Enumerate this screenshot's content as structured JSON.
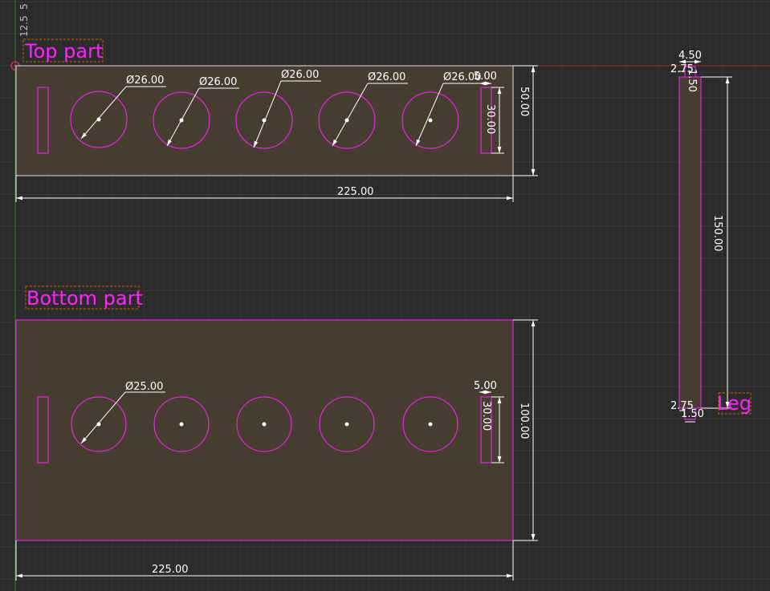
{
  "colors": {
    "background": "#2b2b2b",
    "grid_minor": "#383838",
    "grid_major": "#484848",
    "part_fill": "#4b4031",
    "part_outline_selected": "#ff22ff",
    "part_outline_default": "#e0e0e0",
    "dimension": "#ffffff",
    "axis_x": "#b03030",
    "axis_y": "#2a7a2a"
  },
  "ruler": {
    "left_label": "12.5",
    "left_label_partial": "5"
  },
  "labels": {
    "top_part": "Top part",
    "bottom_part": "Bottom part",
    "leg": "Leg"
  },
  "top_part": {
    "diameters": [
      "Ø26.00",
      "Ø26.00",
      "Ø26.00",
      "Ø26.00",
      "Ø26.00"
    ],
    "width": "225.00",
    "height": "50.00",
    "slot_length": "30.00",
    "slot_offset": "5.00"
  },
  "bottom_part": {
    "diameter": "Ø25.00",
    "width": "225.00",
    "height": "100.00",
    "slot_length": "30.00",
    "slot_offset": "5.00"
  },
  "leg": {
    "width": "4.50",
    "top_offset": "2.75",
    "top_small": "1.50",
    "height": "150.00",
    "bottom_offset": "2.75",
    "bottom_small": "1.50"
  }
}
